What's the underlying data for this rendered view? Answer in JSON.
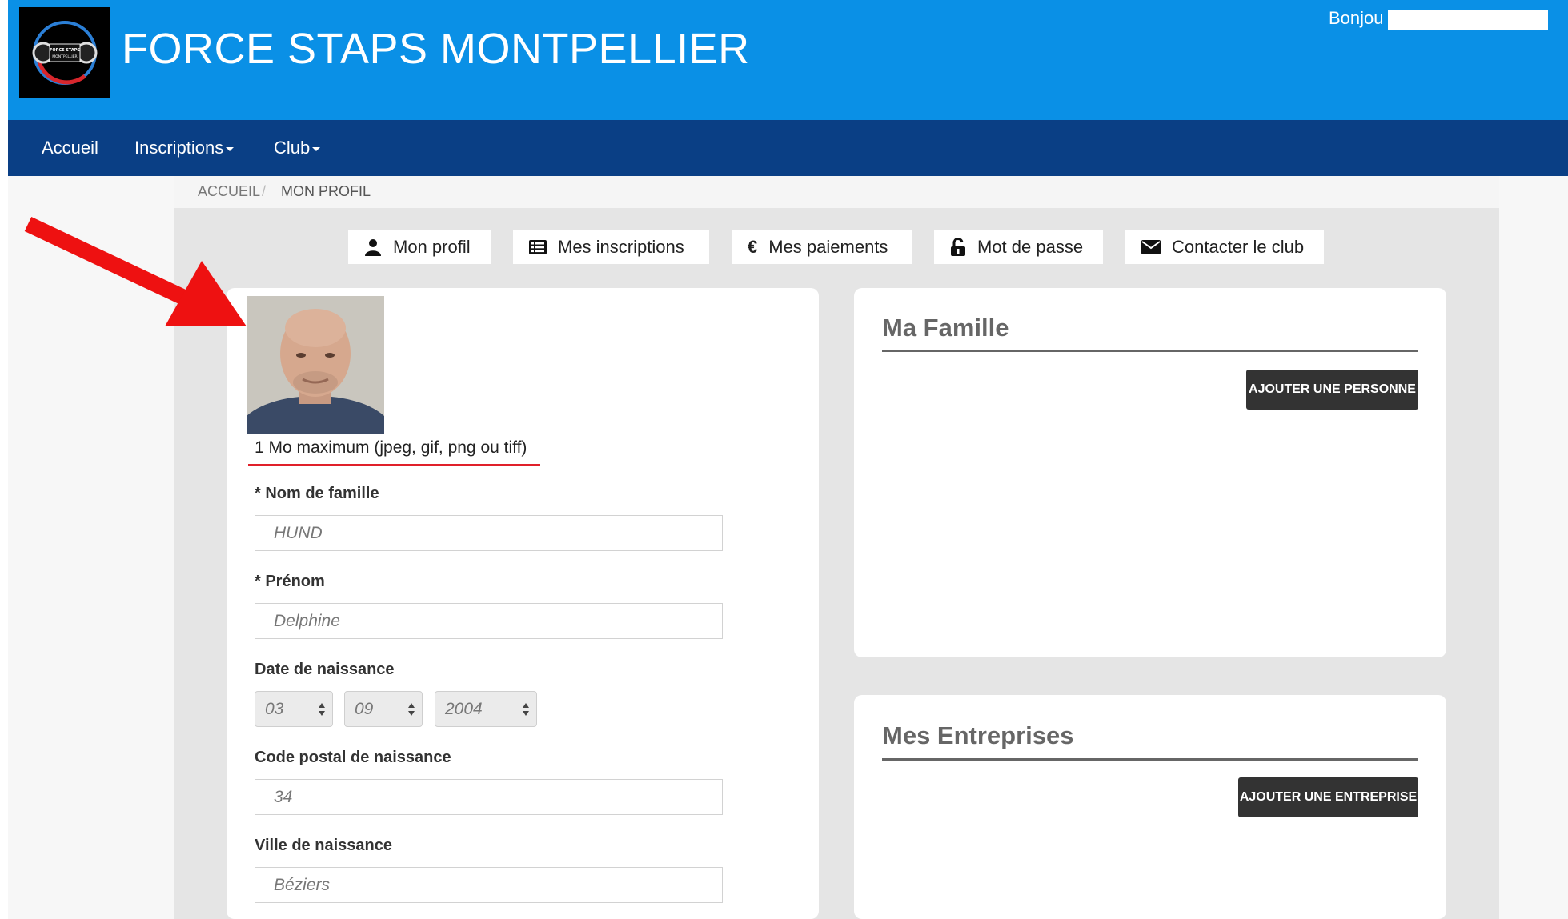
{
  "header": {
    "site_title": "FORCE STAPS MONTPELLIER",
    "greeting": "Bonjou",
    "logo_text": "FORCE STAPS MONTPELLIER"
  },
  "nav": {
    "items": [
      {
        "label": "Accueil",
        "dropdown": false
      },
      {
        "label": "Inscriptions",
        "dropdown": true
      },
      {
        "label": "Club",
        "dropdown": true
      }
    ]
  },
  "breadcrumb": {
    "home": "ACCUEIL",
    "separator": "/",
    "current": "MON PROFIL"
  },
  "tabs": [
    {
      "label": "Mon profil",
      "icon": "user-icon"
    },
    {
      "label": "Mes inscriptions",
      "icon": "list-icon"
    },
    {
      "label": "Mes paiements",
      "icon": "euro-icon"
    },
    {
      "label": "Mot de passe",
      "icon": "unlock-icon"
    },
    {
      "label": "Contacter le club",
      "icon": "envelope-icon"
    }
  ],
  "profile": {
    "photo_alt": "profile-photo",
    "upload_note": "1 Mo maximum (jpeg, gif, png ou tiff)",
    "fields": {
      "nom_label": "* Nom de famille",
      "nom_value": "HUND",
      "prenom_label": "* Prénom",
      "prenom_value": "Delphine",
      "dob_label": "Date de naissance",
      "dob_day": "03",
      "dob_month": "09",
      "dob_year": "2004",
      "cp_label": "Code postal de naissance",
      "cp_value": "34",
      "ville_label": "Ville de naissance",
      "ville_value": "Béziers"
    }
  },
  "famille": {
    "title": "Ma Famille",
    "button": "AJOUTER UNE PERSONNE"
  },
  "entreprises": {
    "title": "Mes Entreprises",
    "button": "AJOUTER UNE ENTREPRISE"
  },
  "colors": {
    "header_bg": "#0a90e6",
    "navbar_bg": "#0a3f85",
    "annotation_arrow": "#ee1111",
    "underline_red": "#e0202a",
    "dark_button": "#333333"
  }
}
